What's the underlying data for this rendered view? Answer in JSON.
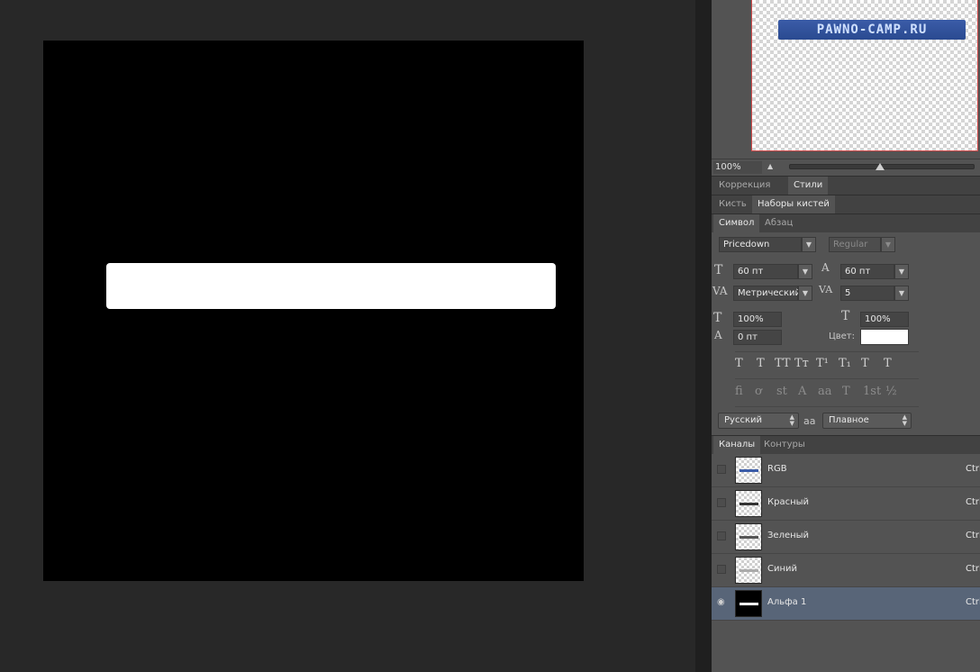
{
  "navigator": {
    "banner_text": "PAWNO-CAMP.RU",
    "zoom_value": "100%"
  },
  "tab_groups": [
    {
      "tabs": [
        "Коррекция",
        "Стили"
      ],
      "active": 1
    },
    {
      "tabs": [
        "Кисть",
        "Наборы кистей"
      ],
      "active": 1
    },
    {
      "tabs": [
        "Символ",
        "Абзац"
      ],
      "active": 0
    },
    {
      "tabs": [
        "Каналы",
        "Контуры"
      ],
      "active": 0
    }
  ],
  "character": {
    "font_family": "Pricedown",
    "font_style": "Regular",
    "font_size": "60 пт",
    "leading": "60 пт",
    "kerning": "Метрический",
    "tracking": "5",
    "vertical_scale": "100%",
    "horizontal_scale": "100%",
    "baseline_shift": "0 пт",
    "color_label": "Цвет:",
    "color_value": "#ffffff",
    "language": "Русский",
    "antialias": "Плавное",
    "antialias_icon_text": "aa",
    "style_buttons": [
      "T",
      "T",
      "TT",
      "Tт",
      "T¹",
      "T₁",
      "T",
      "T"
    ],
    "ligature_buttons": [
      "fi",
      "ơ",
      "st",
      "A",
      "aa",
      "T",
      "1st",
      "½"
    ]
  },
  "channels": [
    {
      "name": "RGB",
      "key": "Ctrl",
      "visible": false,
      "selected": false,
      "bar_color": "#3b5ca8"
    },
    {
      "name": "Красный",
      "key": "Ctrl",
      "visible": false,
      "selected": false,
      "bar_color": "#333333"
    },
    {
      "name": "Зеленый",
      "key": "Ctrl",
      "visible": false,
      "selected": false,
      "bar_color": "#555555"
    },
    {
      "name": "Синий",
      "key": "Ctrl",
      "visible": false,
      "selected": false,
      "bar_color": "#aaaaaa"
    },
    {
      "name": "Альфа 1",
      "key": "Ctrl",
      "visible": true,
      "selected": true,
      "bar_color": "#ffffff"
    }
  ],
  "colors": {
    "canvas_bg": "#000000",
    "selection_fill": "#ffffff",
    "panel_bg": "#535353",
    "selected_row": "#586578"
  }
}
